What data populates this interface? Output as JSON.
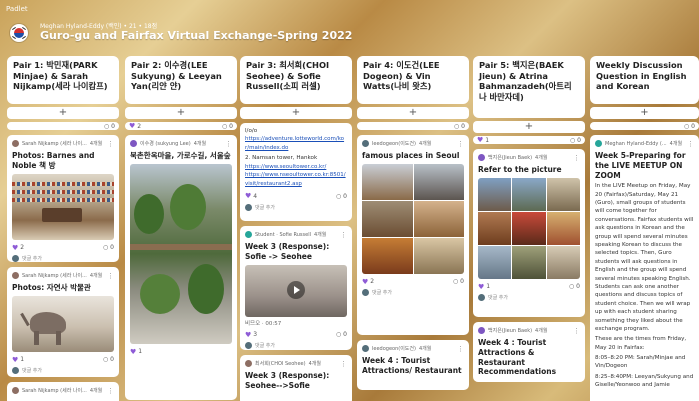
{
  "app": {
    "logo": "Padlet"
  },
  "board": {
    "byline": "Meghan Hyland-Eddy (백인) • 21 • 18점",
    "title": "Guro-gu and Fairfax Virtual Exchange-Spring 2022"
  },
  "colors": {
    "accent": "#8e5bd6",
    "link": "#1a4fb8"
  },
  "add_label": "+",
  "columns": [
    {
      "header": "Pair 1: 박민재(PARK Minjae) & Sarah Nijkamp(세라 나이캄프)",
      "react_top": {
        "likes": "",
        "comments": "0"
      },
      "cards": [
        {
          "author": "Sarah Nijkamp (세라 나이...",
          "time": "4개월",
          "title": "Photos: Barnes and Noble 책 방",
          "likes": "2",
          "comments": "0",
          "add_comment": "댓글 추가"
        },
        {
          "author": "Sarah Nijkamp (세라 나이...",
          "time": "4개월",
          "title": "Photos: 자연사 박물관",
          "likes": "1",
          "comments": "0",
          "add_comment": "댓글 추가"
        },
        {
          "author": "Sarah Nijkamp (세라 나이...",
          "time": "4개월"
        }
      ]
    },
    {
      "header": "Pair 2: 이수경(LEE Sukyung) & Leeyan Yan(리얀 얀)",
      "react_top": {
        "likes": "2",
        "comments": "0"
      },
      "cards": [
        {
          "author": "이수경 (sukyung Lee)",
          "time": "4개월",
          "title": "북촌한옥마을, 가로수길, 서울숲",
          "likes": "1",
          "comments": ""
        }
      ]
    },
    {
      "header": "Pair 3: 최서희(CHOI Seohee) & Sofie Russell(소피 러셀)",
      "cards": [
        {
          "body_top": "l/o/o",
          "links": [
            "https://adventure.lotteworld.com/kor/main/index.do"
          ],
          "body_mid": "2. Namsan tower, Hankok",
          "links2": [
            "https://www.seoultower.co.kr/",
            "https://www.nseoultower.co.kr:8501/visit/restaurant2.asp"
          ],
          "likes": "4",
          "comments": "0",
          "add_comment": "댓글 추가"
        },
        {
          "author": "Student · Sofie Russell",
          "time": "4개월",
          "title": "Week 3 (Response): Sofie -> Seohee",
          "caption": "비므오 · 00:57",
          "likes": "3",
          "comments": "0",
          "add_comment": "댓글 추가"
        },
        {
          "author": "최서희(CHOI Seohee)",
          "time": "4개월",
          "title": "Week 3 (Response): Seohee-->Sofie"
        }
      ]
    },
    {
      "header": "Pair 4: 이도건(LEE Dogeon) & Vin Watts(나비 왓츠)",
      "react_top": {
        "likes": "",
        "comments": "0"
      },
      "cards": [
        {
          "author": "leedogeon(이도건)",
          "time": "4개월",
          "title": "famous places in Seoul",
          "likes": "2",
          "comments": "0",
          "add_comment": "댓글 추가"
        },
        {
          "author": "leedogeon(이도건)",
          "time": "4개월",
          "title": "Week 4 : Tourist Attractions/ Restaurant"
        }
      ]
    },
    {
      "header": "Pair 5: 백지은(BAEK Jieun) & Atrina Bahmanzadeh(아트리나 바만자데)",
      "react_top": {
        "likes": "1",
        "comments": "0"
      },
      "cards": [
        {
          "author": "백지은(Jieun Baek)",
          "time": "4개월",
          "title": "Refer to the picture",
          "likes": "1",
          "comments": "0",
          "add_comment": "댓글 추가"
        },
        {
          "author": "백지은(Jieun Baek)",
          "time": "4개월",
          "title": "Week 4 : Tourist Attractions & Restaurant Recommendations"
        }
      ]
    }
  ],
  "sidebar": {
    "header": "Weekly Discussion Question in English and Korean",
    "react_top": {
      "likes": "",
      "comments": "0"
    },
    "card": {
      "author": "Meghan Hyland-Eddy (...",
      "time": "4개월",
      "title": "Week 5-Preparing for the LIVE MEETUP ON ZOOM",
      "body": "In the LIVE Meetup on Friday, May 20 (Fairfax)/Saturday, May 21 (Guro), small groups of students will come together for conversations.  Fairfax students will ask questions in Korean and the group will spend several minutes speaking Korean to discuss the selected topics.  Then, Guro students will ask questions in English and the group will spend several minutes speaking English. Students can ask one another questions and discuss topics of student choice. Then we will wrap up with each student sharing something they liked about the exchange program.",
      "body2": "These are the times from Friday, May 20 in Fairfax:",
      "body3": "8:05–8:20 PM: Sarah/Minjae and Vin/Dogeon",
      "body4": "8:25–8:40PM: Leeyan/Sukyung and Giselle/Yeonwoo and Jamie"
    }
  }
}
